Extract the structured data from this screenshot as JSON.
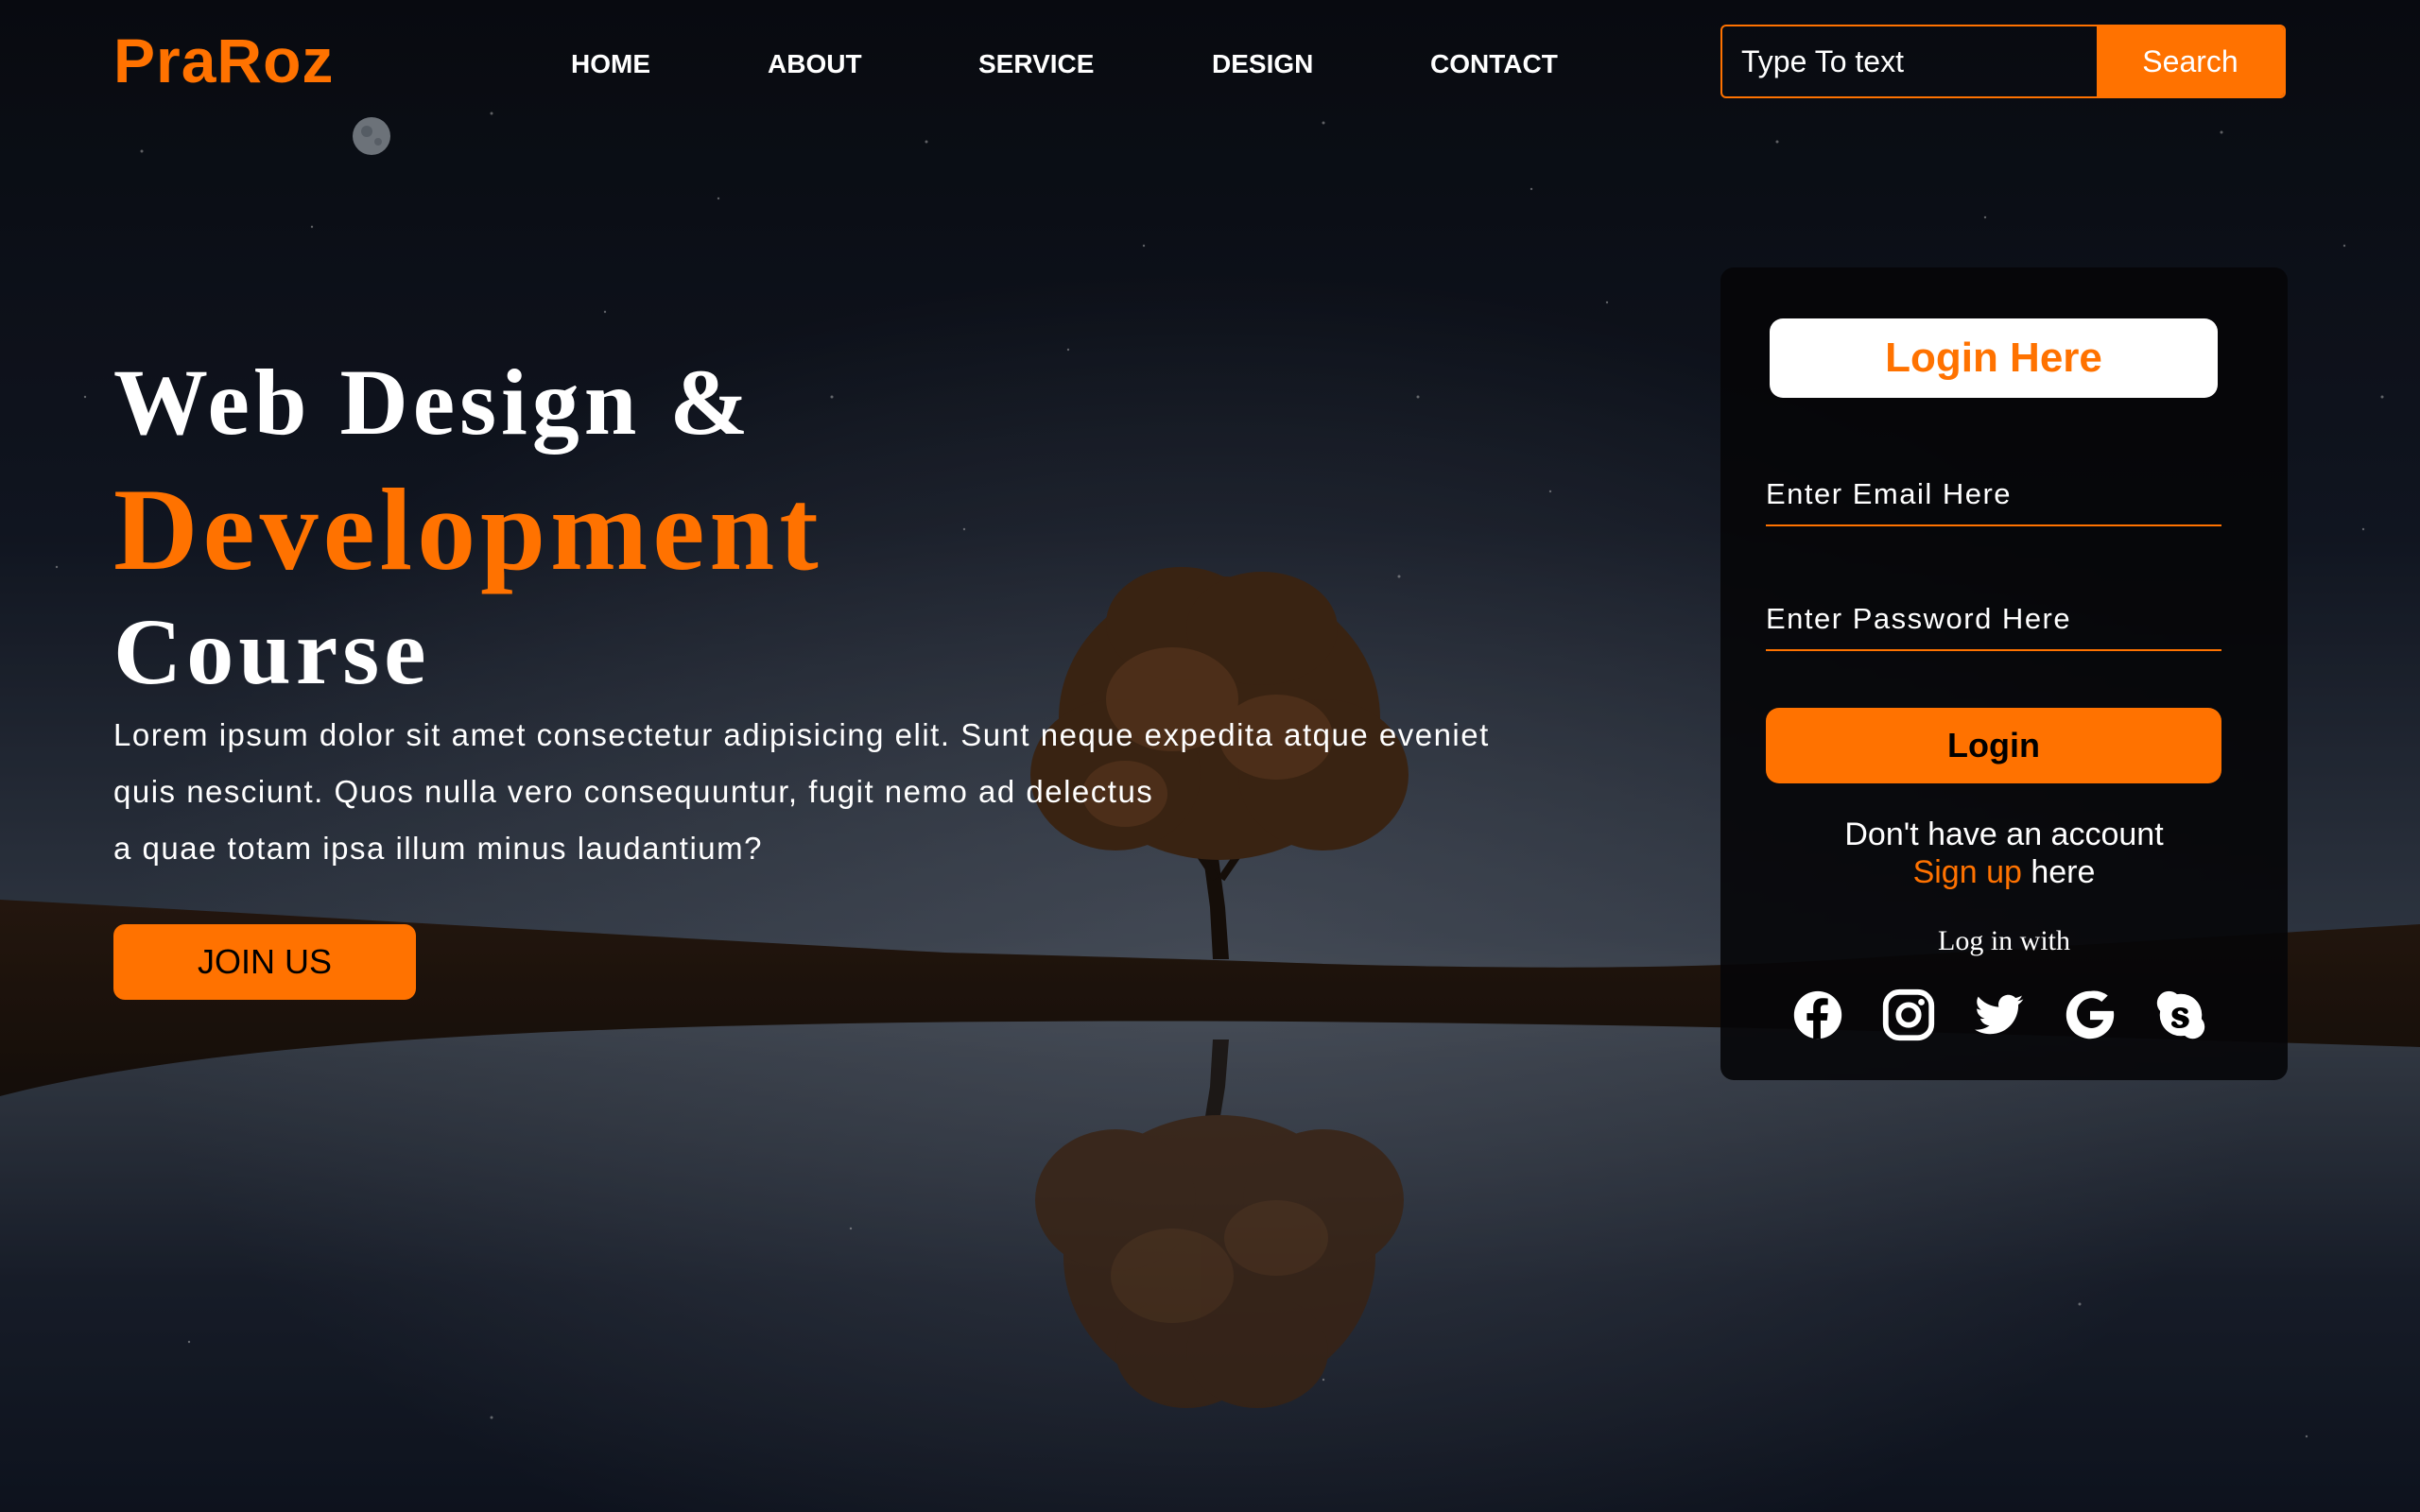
{
  "brand": {
    "name": "PraRoz",
    "accent_color": "#ff7200"
  },
  "nav": {
    "items": [
      {
        "label": "HOME"
      },
      {
        "label": "ABOUT"
      },
      {
        "label": "SERVICE"
      },
      {
        "label": "DESIGN"
      },
      {
        "label": "CONTACT"
      }
    ]
  },
  "search": {
    "placeholder": "Type To text",
    "button_label": "Search"
  },
  "hero": {
    "line1": "Web Design &",
    "line2": "Development",
    "line3": "Course",
    "paragraph_lines": [
      "Lorem ipsum dolor sit amet consectetur adipisicing elit. Sunt neque expedita atque eveniet",
      "quis nesciunt. Quos nulla vero consequuntur, fugit nemo ad delectus",
      "a quae totam ipsa illum minus laudantium?"
    ],
    "cta_label": "JOIN US"
  },
  "login": {
    "title": "Login Here",
    "email_placeholder": "Enter Email Here",
    "password_placeholder": "Enter Password Here",
    "button_label": "Login",
    "no_account_text": "Don't have an account",
    "signup_link": "Sign up",
    "signup_suffix": " here",
    "login_with_text": "Log in with",
    "social_icons": [
      "facebook-icon",
      "instagram-icon",
      "twitter-icon",
      "google-icon",
      "skype-icon"
    ]
  }
}
